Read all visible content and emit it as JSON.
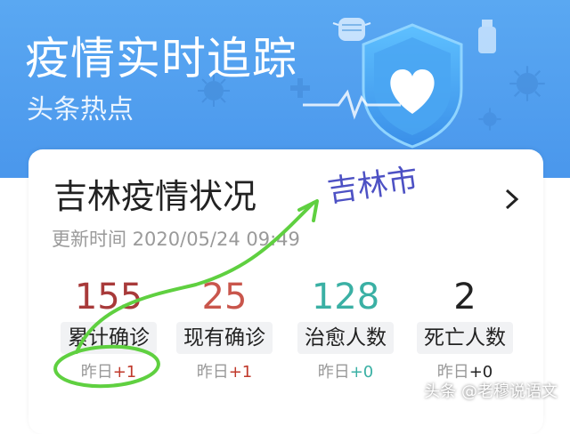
{
  "banner": {
    "title": "疫情实时追踪",
    "subtitle": "头条热点"
  },
  "card": {
    "title": "吉林疫情状况",
    "updated": "更新时间 2020/05/24 09:49",
    "stats": [
      {
        "value": "155",
        "label": "累计确诊",
        "delta_prefix": "昨日",
        "delta": "+1",
        "value_color": "#a83a3a",
        "delta_color": "#c0392b"
      },
      {
        "value": "25",
        "label": "现有确诊",
        "delta_prefix": "昨日",
        "delta": "+1",
        "value_color": "#c9564c",
        "delta_color": "#c0392b"
      },
      {
        "value": "128",
        "label": "治愈人数",
        "delta_prefix": "昨日",
        "delta": "+0",
        "value_color": "#3ab0a4",
        "delta_color": "#3ab0a4"
      },
      {
        "value": "2",
        "label": "死亡人数",
        "delta_prefix": "昨日",
        "delta": "+0",
        "value_color": "#222222",
        "delta_color": "#222222"
      }
    ]
  },
  "annotation": {
    "text": "吉林市",
    "ink_color": "#5fd040",
    "text_color": "#4d51c4"
  },
  "watermark": "头条 @老穆说语文",
  "icons": [
    "shield-heart-icon",
    "virus-icon",
    "mask-icon",
    "chevron-right-icon"
  ]
}
